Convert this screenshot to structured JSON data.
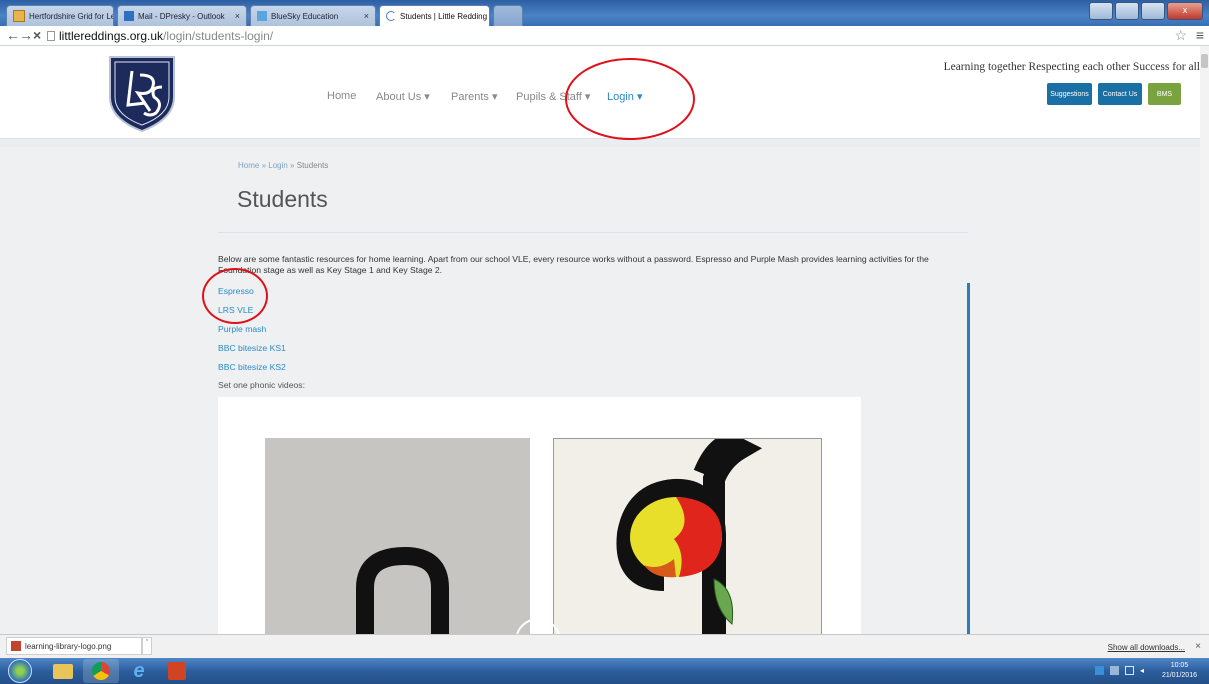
{
  "browser": {
    "tabs": [
      {
        "label": "Hertfordshire Grid for Lea",
        "close": "×"
      },
      {
        "label": "Mail - DPresky - Outlook",
        "close": "×"
      },
      {
        "label": "BlueSky Education",
        "close": "×"
      },
      {
        "label": "Students | Little Redding",
        "close": "×"
      }
    ],
    "url_host": "littlereddings.org.uk",
    "url_path": "/login/students-login/",
    "back_icon": "←",
    "forward_icon": "→",
    "stop_icon": "×",
    "star_icon": "☆",
    "menu_icon": "≡"
  },
  "site": {
    "nav": [
      "Home",
      "About Us ▾",
      "Parents ▾",
      "Pupils & Staff ▾",
      "Login ▾"
    ],
    "tagline": "Learning together Respecting each other Success for all",
    "buttons": [
      {
        "label": "Suggestions",
        "color": "#1a6fa5"
      },
      {
        "label": "Contact Us",
        "color": "#1a6fa5"
      },
      {
        "label": "BMS",
        "color": "#7aa23f"
      }
    ]
  },
  "page": {
    "breadcrumb": {
      "home": "Home",
      "sep1": " » ",
      "login": "Login",
      "sep2": " » ",
      "current": "Students"
    },
    "title": "Students",
    "intro": "Below are some fantastic resources for home learning. Apart from our school VLE, every resource works without a password. Espresso and Purple Mash provides learning activities for the Foundation stage as well as Key Stage 1 and Key Stage 2.",
    "links": [
      "Espresso",
      "LRS VLE",
      "Purple mash",
      "BBC bitesize KS1",
      "BBC bitesize KS2"
    ],
    "phonic_label": "Set one phonic videos:"
  },
  "downloads": {
    "file": "learning-library-logo.png",
    "show_all": "Show all downloads...",
    "close": "×"
  },
  "taskbar": {
    "time": "10:05",
    "date": "21/01/2016"
  },
  "colors": {
    "accent_blue": "#2a8bc7",
    "annotation_red": "#e01018"
  }
}
